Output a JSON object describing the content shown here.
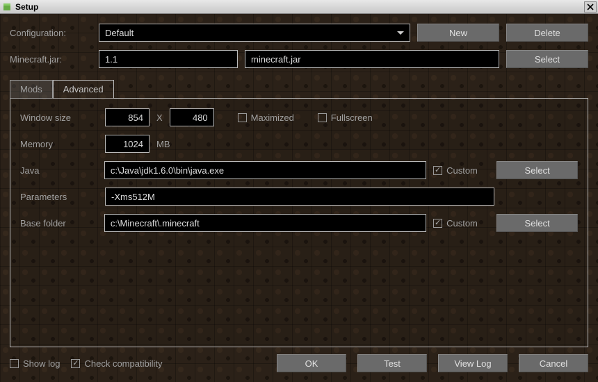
{
  "window": {
    "title": "Setup"
  },
  "config": {
    "label": "Configuration:",
    "selected": "Default",
    "new_btn": "New",
    "delete_btn": "Delete"
  },
  "jar": {
    "label": "Minecraft.jar:",
    "version": "1.1",
    "filename": "minecraft.jar",
    "select_btn": "Select"
  },
  "tabs": {
    "mods": "Mods",
    "advanced": "Advanced"
  },
  "advanced": {
    "window_size_label": "Window size",
    "width": "854",
    "height": "480",
    "x": "X",
    "maximized_label": "Maximized",
    "maximized_checked": false,
    "fullscreen_label": "Fullscreen",
    "fullscreen_checked": false,
    "memory_label": "Memory",
    "memory_value": "1024",
    "memory_unit": "MB",
    "java_label": "Java",
    "java_path": "c:\\Java\\jdk1.6.0\\bin\\java.exe",
    "java_custom_label": "Custom",
    "java_custom_checked": true,
    "java_select_btn": "Select",
    "params_label": "Parameters",
    "params_value": "-Xms512M",
    "base_label": "Base folder",
    "base_path": "c:\\Minecraft\\.minecraft",
    "base_custom_label": "Custom",
    "base_custom_checked": true,
    "base_select_btn": "Select"
  },
  "footer": {
    "showlog_label": "Show log",
    "showlog_checked": false,
    "checkcompat_label": "Check compatibility",
    "checkcompat_checked": true,
    "ok": "OK",
    "test": "Test",
    "viewlog": "View Log",
    "cancel": "Cancel"
  }
}
